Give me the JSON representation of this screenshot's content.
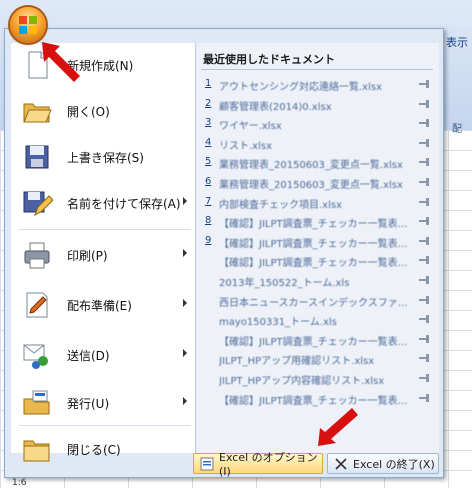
{
  "background": {
    "tab_fragment": "表示",
    "group_fragment": "配",
    "cell_ref": "1:6"
  },
  "menu": {
    "items": [
      {
        "label": "新規作成(N)",
        "icon": "new-document-icon",
        "submenu": false
      },
      {
        "label": "開く(O)",
        "icon": "open-folder-icon",
        "submenu": false
      },
      {
        "label": "上書き保存(S)",
        "icon": "save-disk-icon",
        "submenu": false
      },
      {
        "label": "名前を付けて保存(A)",
        "icon": "save-as-icon",
        "submenu": true
      },
      {
        "label": "印刷(P)",
        "icon": "printer-icon",
        "submenu": true
      },
      {
        "label": "配布準備(E)",
        "icon": "prepare-icon",
        "submenu": true
      },
      {
        "label": "送信(D)",
        "icon": "send-icon",
        "submenu": true
      },
      {
        "label": "発行(U)",
        "icon": "publish-icon",
        "submenu": true
      },
      {
        "label": "閉じる(C)",
        "icon": "close-folder-icon",
        "submenu": false
      }
    ],
    "recent": {
      "title": "最近使用したドキュメント",
      "documents": [
        {
          "num": "1",
          "name": "アウトセンシング対応連絡一覧.xlsx"
        },
        {
          "num": "2",
          "name": "顧客管理表(2014)0.xlsx"
        },
        {
          "num": "3",
          "name": "ワイヤー.xlsx"
        },
        {
          "num": "4",
          "name": "リスト.xlsx"
        },
        {
          "num": "5",
          "name": "業務管理表_20150603_変更点一覧.xlsx"
        },
        {
          "num": "6",
          "name": "業務管理表_20150603_変更点一覧.xlsx"
        },
        {
          "num": "7",
          "name": "内部検査チェック項目.xlsx"
        },
        {
          "num": "8",
          "name": "【確認】JILPT調査票_チェッカー一覧表.xlsx"
        },
        {
          "num": "9",
          "name": "【確認】JILPT調査票_チェッカー一覧表.xlsx"
        },
        {
          "num": "",
          "name": "【確認】JILPT調査票_チェッカー一覧表.xlsx"
        },
        {
          "num": "",
          "name": "2013年_150522_トーム.xls"
        },
        {
          "num": "",
          "name": "西日本ニュースカースインデックスファイル.xlsx"
        },
        {
          "num": "",
          "name": "mayo150331_トーム.xls"
        },
        {
          "num": "",
          "name": "【確認】JILPT調査票_チェッカー一覧表.xlsx"
        },
        {
          "num": "",
          "name": "JILPT_HPアップ用確認リスト.xlsx"
        },
        {
          "num": "",
          "name": "JILPT_HPアップ内容確認リスト.xlsx"
        },
        {
          "num": "",
          "name": "【確認】JILPT調査票_チェッカー一覧表.xlsx"
        }
      ]
    },
    "options_button": "Excel のオプション(I)",
    "exit_button": "Excel の終了(X)"
  },
  "colors": {
    "accent_red": "#d80f0f",
    "link_blue": "#15428b",
    "hot_button": "#ffd878"
  }
}
